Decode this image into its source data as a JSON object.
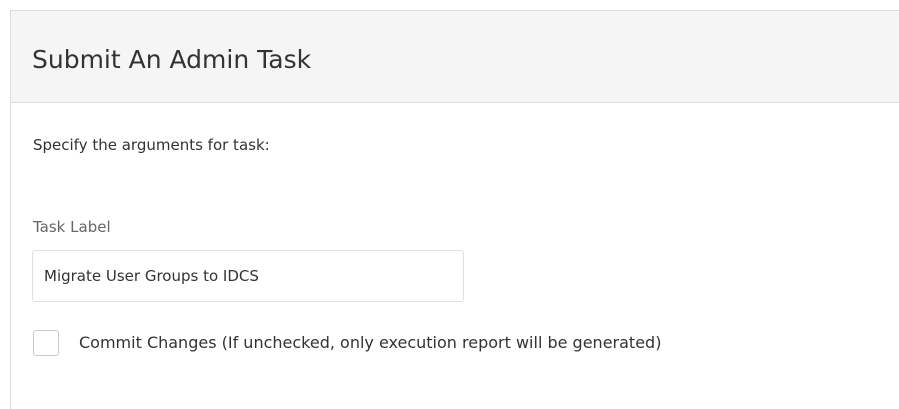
{
  "dialog": {
    "title": "Submit An Admin Task",
    "instructions": "Specify the arguments for task:"
  },
  "task_label_field": {
    "label": "Task Label",
    "value": "Migrate User Groups to IDCS"
  },
  "commit_changes": {
    "label": "Commit Changes (If unchecked, only execution report will be generated)",
    "checked": false
  }
}
